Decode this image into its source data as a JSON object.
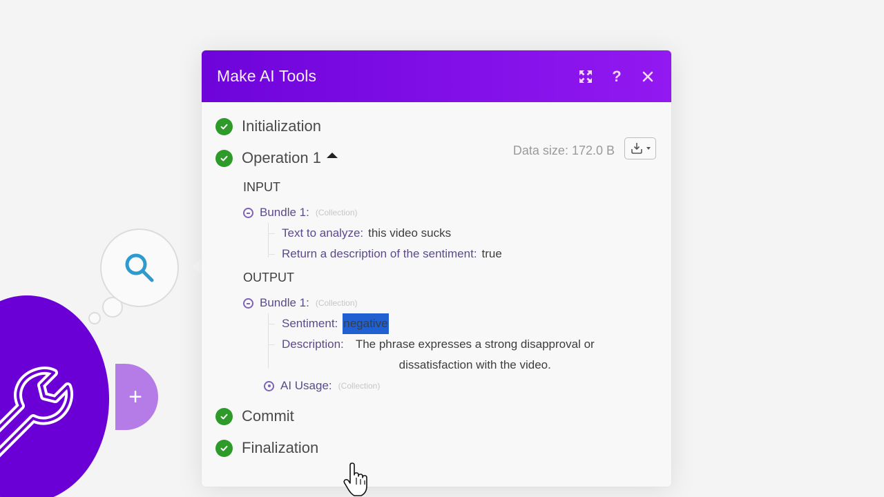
{
  "canvas": {
    "search_node_icon": "search-icon",
    "tools_node_icon": "wrench-icon",
    "add_node_label": "+",
    "accent_color": "#6a00d6",
    "search_icon_color": "#2d9ad0"
  },
  "panel": {
    "title": "Make AI Tools",
    "header_gradient": [
      "#6d04da",
      "#9219f0"
    ],
    "header_buttons": [
      {
        "name": "expand",
        "icon": "expand-icon"
      },
      {
        "name": "help",
        "icon": "help-icon",
        "glyph": "?"
      },
      {
        "name": "close",
        "icon": "close-icon",
        "glyph": "×"
      }
    ],
    "data_size_label": "Data size: 172.0 B",
    "download_button_icon": "download-icon",
    "status_color": "#2e9a2a"
  },
  "steps": {
    "initialization": "Initialization",
    "operation": "Operation 1",
    "commit": "Commit",
    "finalization": "Finalization"
  },
  "input": {
    "title": "INPUT",
    "bundle_label": "Bundle 1:",
    "bundle_type": "(Collection)",
    "fields": [
      {
        "key": "Text to analyze:",
        "value": "this video sucks"
      },
      {
        "key": "Return a description of the sentiment:",
        "value": "true"
      }
    ]
  },
  "output": {
    "title": "OUTPUT",
    "bundle_label": "Bundle 1:",
    "bundle_type": "(Collection)",
    "fields": [
      {
        "key": "Sentiment:",
        "value": "negative",
        "selected": true
      },
      {
        "key": "Description:",
        "value": "The phrase expresses a strong disapproval or dissatisfaction with the video."
      }
    ],
    "ai_usage_label": "AI Usage:",
    "ai_usage_type": "(Collection)"
  }
}
